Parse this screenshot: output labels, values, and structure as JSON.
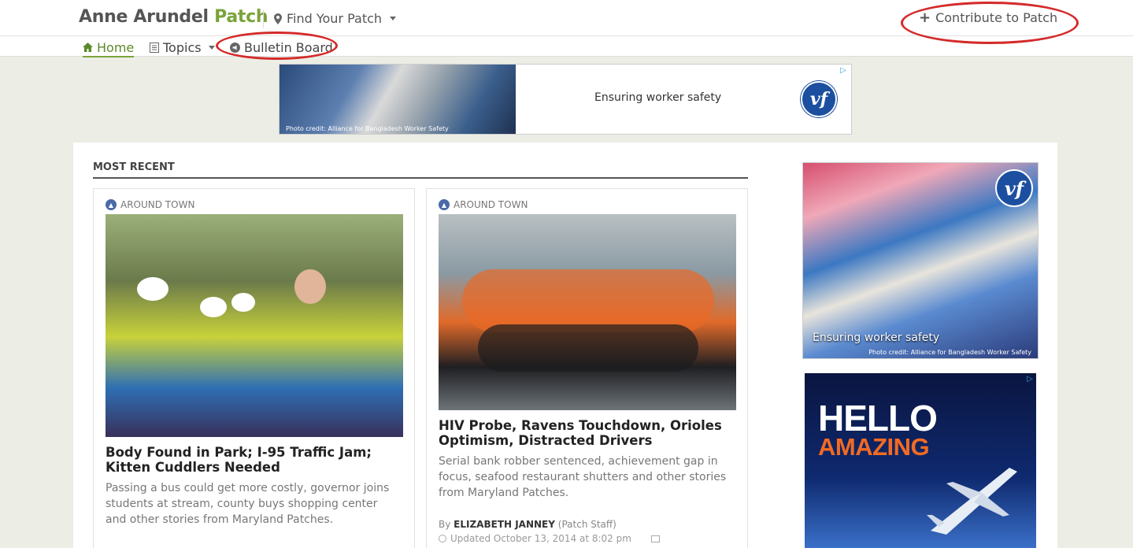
{
  "header": {
    "brand_name": "Anne Arundel",
    "brand_patch": "Patch",
    "find_patch": "Find Your Patch",
    "contribute": "Contribute to Patch"
  },
  "nav": {
    "home": "Home",
    "topics": "Topics",
    "bulletin": "Bulletin Board"
  },
  "top_ad": {
    "text": "Ensuring worker safety",
    "credit": "Photo credit: Alliance for Bangladesh Worker Safety",
    "logo": "vf"
  },
  "section": {
    "title": "MOST RECENT"
  },
  "articles": [
    {
      "category": "AROUND TOWN",
      "headline": "Body Found in Park; I-95 Traffic Jam; Kitten Cuddlers Needed",
      "description": "Passing a bus could get more costly, governor joins students at stream, county buys shopping center and other stories from Maryland Patches."
    },
    {
      "category": "AROUND TOWN",
      "headline": "HIV Probe, Ravens Touchdown, Orioles Optimism, Distracted Drivers",
      "description": "Serial bank robber sentenced, achievement gap in focus, seafood restaurant shutters and other stories from Maryland Patches.",
      "byline_prefix": "By",
      "author": "ELIZABETH JANNEY",
      "author_role": "(Patch Staff)",
      "updated": "Updated October 13, 2014 at 8:02 pm"
    }
  ],
  "side_ad1": {
    "text": "Ensuring worker safety",
    "credit": "Photo credit: Alliance for Bangladesh Worker Safety",
    "logo": "vf"
  },
  "side_ad2": {
    "line1": "HELLO",
    "line2": "AMAZING"
  },
  "colors": {
    "accent_green": "#7aa33a",
    "annotation_red": "#d42a2a",
    "page_bg": "#eceee6"
  }
}
